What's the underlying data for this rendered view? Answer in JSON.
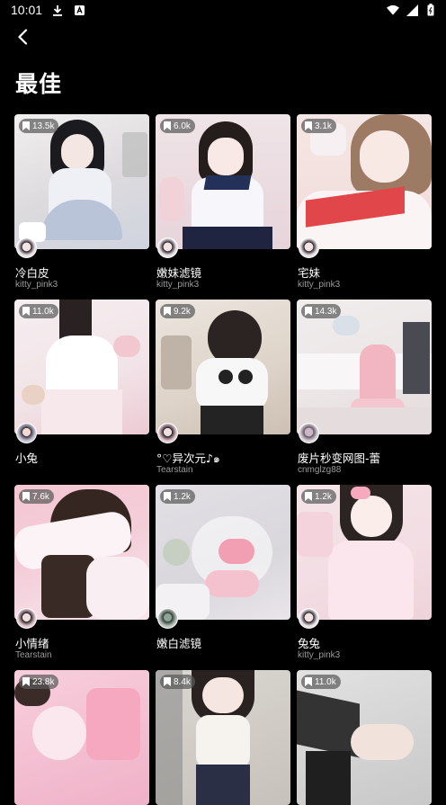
{
  "status_bar": {
    "time": "10:01",
    "icons": [
      "download-icon",
      "notification-a-icon",
      "wifi-icon",
      "cellular-signal-icon",
      "battery-icon"
    ]
  },
  "header": {
    "back_icon": "chevron-left-icon",
    "title": "最佳"
  },
  "cards": [
    {
      "count": "13.5k",
      "title": "冷白皮",
      "author": "kitty_pink3",
      "palette": [
        "#e9e6e6",
        "#c9cfdb"
      ]
    },
    {
      "count": "6.0k",
      "title": "嫩妹滤镜",
      "author": "kitty_pink3",
      "palette": [
        "#e8d7db",
        "#1f2a4a"
      ]
    },
    {
      "count": "3.1k",
      "title": "宅妹",
      "author": "kitty_pink3",
      "palette": [
        "#f1d9d8",
        "#e0484a"
      ]
    },
    {
      "count": "11.0k",
      "title": "小兔",
      "author": "",
      "palette": [
        "#f3e9ec",
        "#e9b9c3"
      ]
    },
    {
      "count": "9.2k",
      "title": "°♡异次元♪๑",
      "author": "Tearstain",
      "palette": [
        "#e9e2da",
        "#2a2a2a"
      ]
    },
    {
      "count": "14.3k",
      "title": "废片秒变网图-蕾",
      "author": "cnmglzg88",
      "palette": [
        "#eeeaea",
        "#f0b7c2"
      ]
    },
    {
      "count": "7.6k",
      "title": "小情绪",
      "author": "Tearstain",
      "palette": [
        "#f6c9d6",
        "#f8eef2"
      ]
    },
    {
      "count": "1.2k",
      "title": "嫩白滤镜",
      "author": "",
      "palette": [
        "#e4e2e6",
        "#f3c0cf"
      ]
    },
    {
      "count": "1.2k",
      "title": "兔兔",
      "author": "kitty_pink3",
      "palette": [
        "#f3dfe4",
        "#f5c9d6"
      ]
    },
    {
      "count": "23.8k",
      "title": "",
      "author": "",
      "palette": [
        "#f7cfdc",
        "#efaec4"
      ]
    },
    {
      "count": "8.4k",
      "title": "",
      "author": "",
      "palette": [
        "#d8d6d2",
        "#2b2f45"
      ]
    },
    {
      "count": "11.0k",
      "title": "",
      "author": "",
      "palette": [
        "#d9d9d9",
        "#2a2a2a"
      ]
    }
  ]
}
